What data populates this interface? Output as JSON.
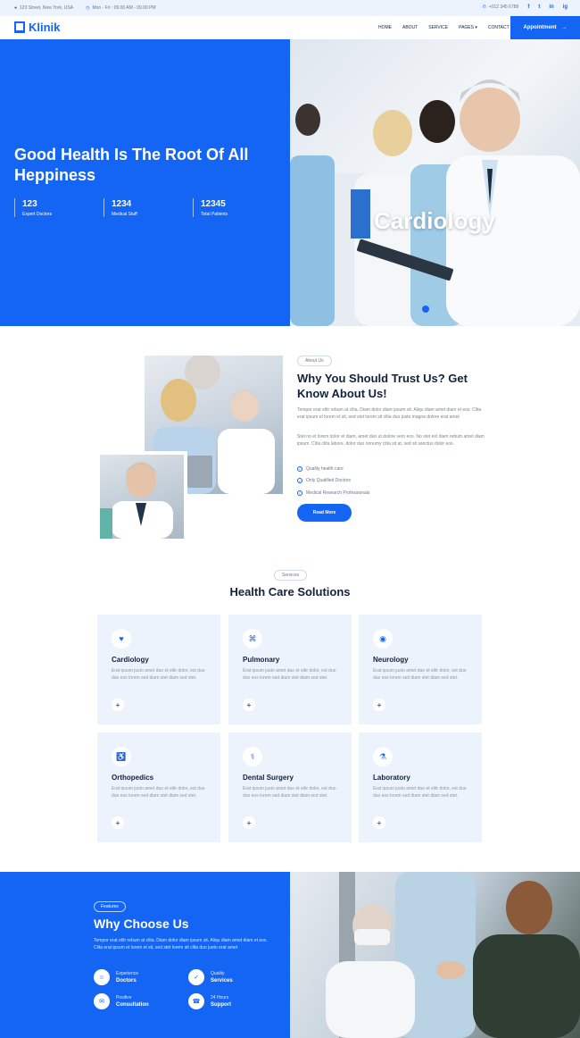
{
  "topbar": {
    "address": "123 Street, New York, USA",
    "hours": "Mon - Fri : 09.00 AM - 09.00 PM",
    "phone": "+012 345 6789",
    "social": [
      "f",
      "t",
      "in",
      "ig"
    ]
  },
  "nav": {
    "brand": "Klinik",
    "menu": [
      "HOME",
      "ABOUT",
      "SERVICE",
      "PAGES",
      "CONTACT"
    ],
    "appointment": "Appointment"
  },
  "hero": {
    "title": "Good Health Is The Root Of All Heppiness",
    "image_caption": "Cardiology",
    "stats": [
      {
        "number": "123",
        "label": "Expert Doctors"
      },
      {
        "number": "1234",
        "label": "Medical Stuff"
      },
      {
        "number": "12345",
        "label": "Total Patients"
      }
    ]
  },
  "about": {
    "pill": "About Us",
    "title": "Why You Should Trust Us? Get Know About Us!",
    "p1": "Tempor erat elitr rebum at clita. Diam dolor diam ipsum sit. Aliqu diam amet diam et eos. Clita erat ipsum et lorem et sit, sed stet lorem sit clita duo justo magna dolore erat amet",
    "p2": "Stet no et lorem dolor et diam, amet duo ut dolore vero eos. No stet est diam rebum amet diam ipsum. Clita clita labore, dolor duo nonumy clita sit at, sed sit sanctus dolor eos.",
    "checks": [
      "Quality health care",
      "Only Qualified Doctors",
      "Medical Research Professionals"
    ],
    "button": "Read More"
  },
  "services": {
    "pill": "Services",
    "title": "Health Care Solutions",
    "desc": "Erat ipsum justo amet duo et elitr dolor, est duo duo eos lorem sed diam stet diam sed stet.",
    "cards": [
      {
        "title": "Cardiology",
        "icon": "heart-pulse-icon",
        "glyph": "♥"
      },
      {
        "title": "Pulmonary",
        "icon": "lungs-icon",
        "glyph": "⌘"
      },
      {
        "title": "Neurology",
        "icon": "brain-icon",
        "glyph": "◉"
      },
      {
        "title": "Orthopedics",
        "icon": "wheelchair-icon",
        "glyph": "♿"
      },
      {
        "title": "Dental Surgery",
        "icon": "tooth-icon",
        "glyph": "⚕"
      },
      {
        "title": "Laboratory",
        "icon": "vials-icon",
        "glyph": "⚗"
      }
    ]
  },
  "why": {
    "pill": "Features",
    "title": "Why Choose Us",
    "p": "Tempor erat elitr rebum at clita. Diam dolor diam ipsum sit. Aliqu diam amet diam et eos. Clita erat ipsum et lorem et sit, sed stet lorem sit clita duo justo erat amet",
    "features": [
      {
        "top": "Experience",
        "bottom": "Doctors",
        "icon": "user-md-icon",
        "glyph": "☺"
      },
      {
        "top": "Quality",
        "bottom": "Services",
        "icon": "check-icon",
        "glyph": "✓"
      },
      {
        "top": "Positive",
        "bottom": "Consultation",
        "icon": "comment-icon",
        "glyph": "✉"
      },
      {
        "top": "24 Hours",
        "bottom": "Support",
        "icon": "headset-icon",
        "glyph": "☎"
      }
    ]
  },
  "colors": {
    "primary": "#1565f5",
    "light": "#edf3fd",
    "dark": "#13213a"
  }
}
